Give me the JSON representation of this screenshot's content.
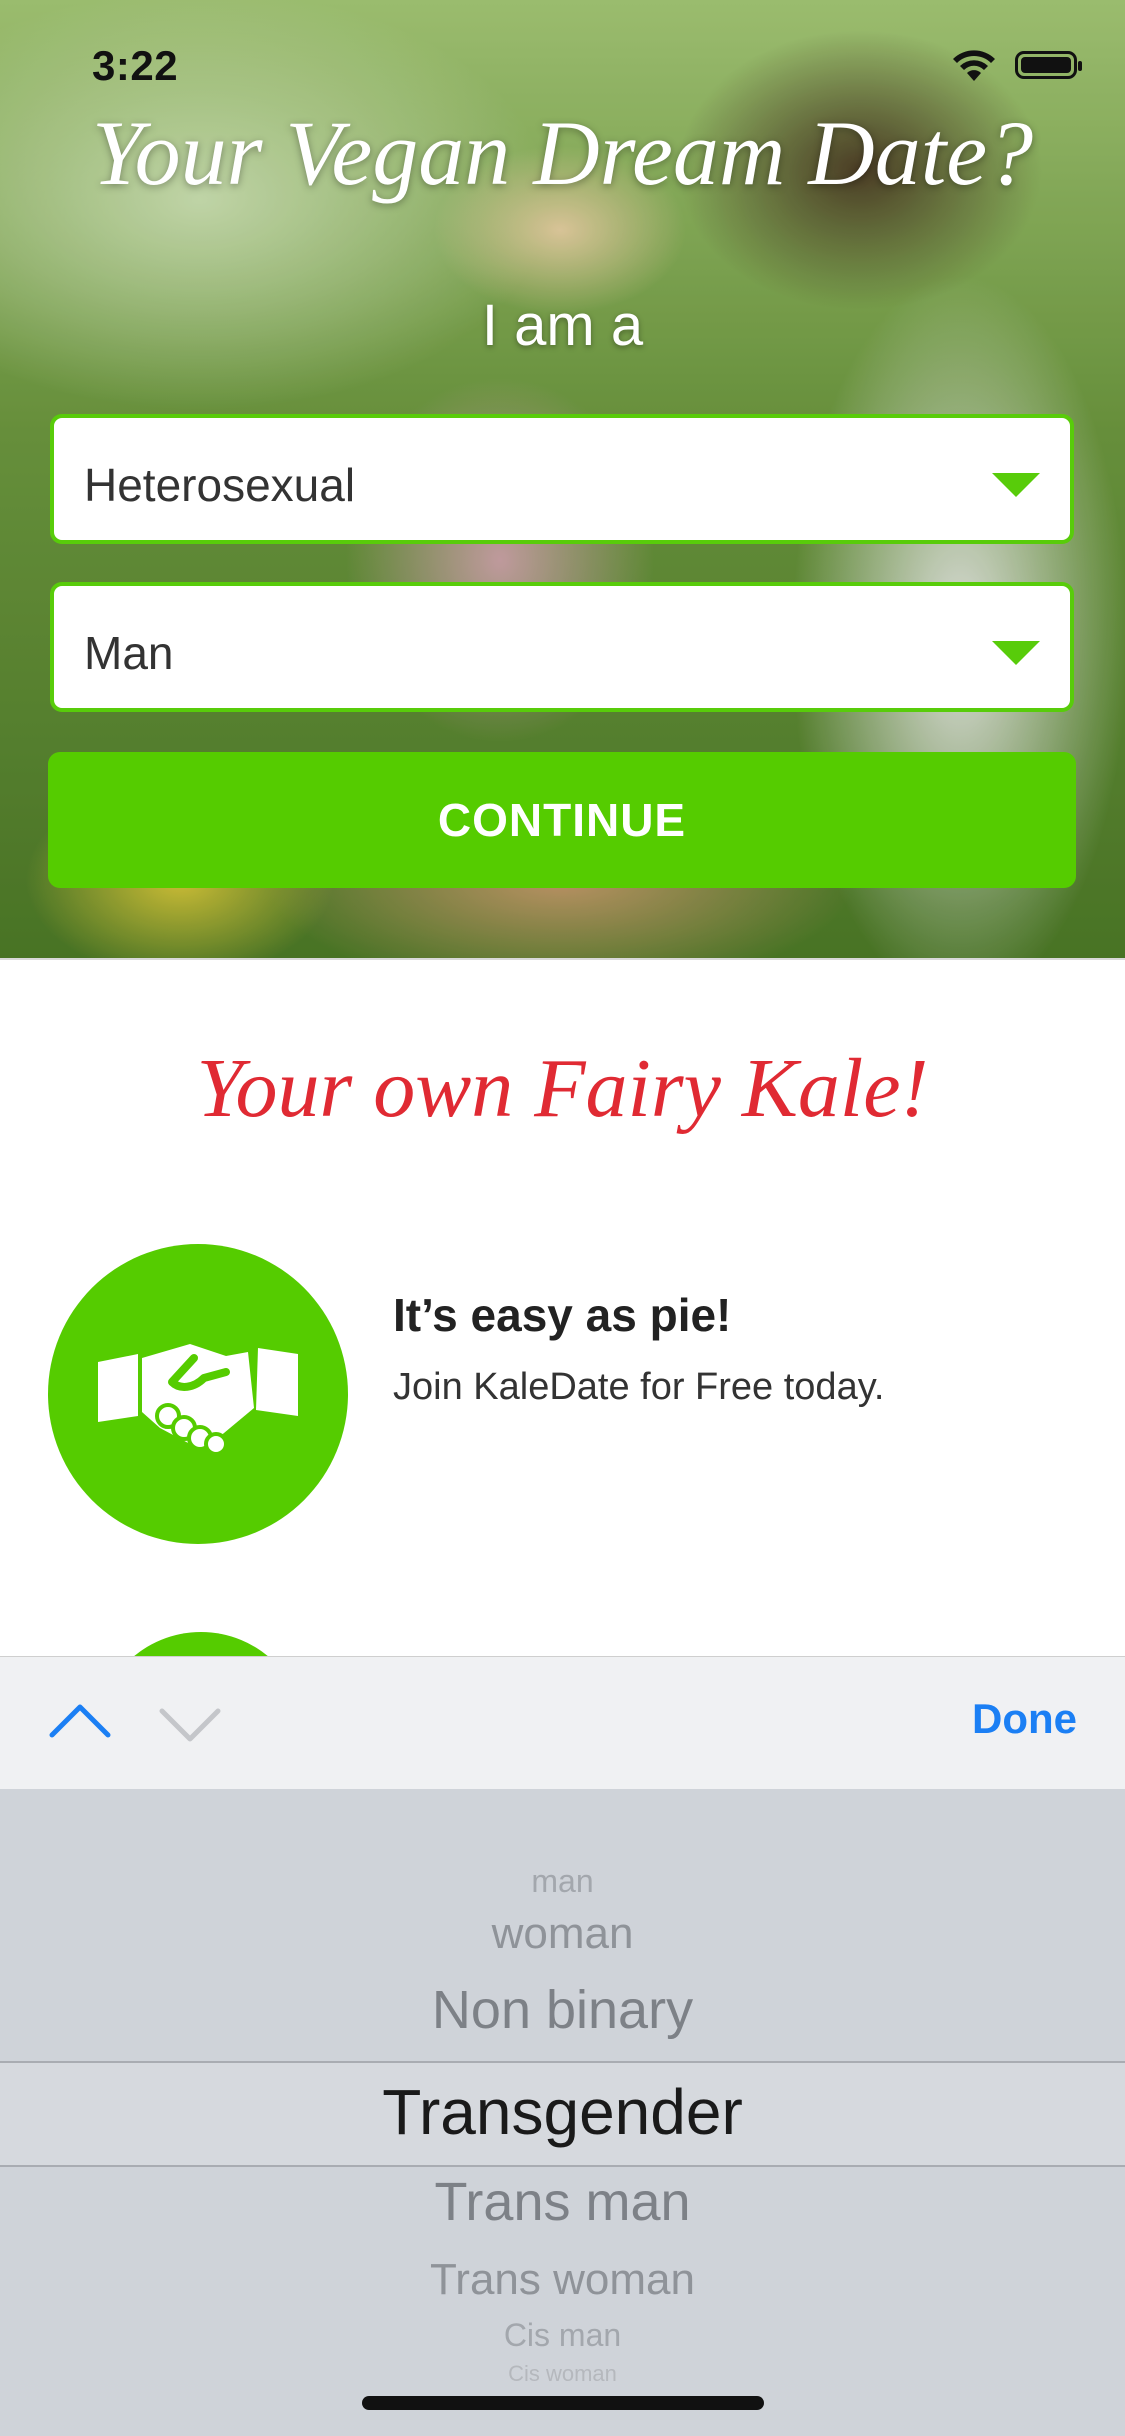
{
  "status_bar": {
    "time": "3:22"
  },
  "hero": {
    "title": "Your Vegan Dream Date?",
    "subtitle": "I am a",
    "orientation_select": {
      "value": "Heterosexual"
    },
    "gender_select": {
      "value": "Man"
    },
    "continue_label": "CONTINUE"
  },
  "content": {
    "tagline": "Your own Fairy Kale!",
    "features": [
      {
        "icon": "handshake-icon",
        "title": "It’s easy as pie!",
        "description": "Join KaleDate for Free today."
      }
    ]
  },
  "accessory_bar": {
    "done_label": "Done"
  },
  "picker": {
    "options": [
      "man",
      "woman",
      "Non binary",
      "Transgender",
      "Trans man",
      "Trans woman",
      "Cis man",
      "Cis woman"
    ],
    "selected": "Transgender"
  },
  "colors": {
    "accent_green": "#55cc00",
    "tagline_red": "#e02a33",
    "ios_blue": "#1b7ff4"
  }
}
